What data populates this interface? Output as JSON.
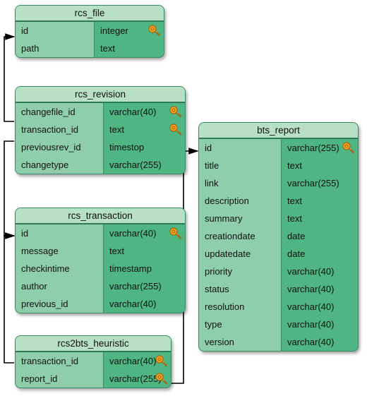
{
  "tables": {
    "rcs_file": {
      "title": "rcs_file",
      "cols": [
        {
          "name": "id",
          "type": "integer",
          "key": true
        },
        {
          "name": "path",
          "type": "text",
          "key": false
        }
      ]
    },
    "rcs_revision": {
      "title": "rcs_revision",
      "cols": [
        {
          "name": "changefile_id",
          "type": "varchar(40)",
          "key": true
        },
        {
          "name": "transaction_id",
          "type": "text",
          "key": true
        },
        {
          "name": "previousrev_id",
          "type": "timestop",
          "key": false
        },
        {
          "name": "changetype",
          "type": "varchar(255)",
          "key": false
        }
      ]
    },
    "rcs_transaction": {
      "title": "rcs_transaction",
      "cols": [
        {
          "name": "id",
          "type": "varchar(40)",
          "key": true
        },
        {
          "name": "message",
          "type": "text",
          "key": false
        },
        {
          "name": "checkintime",
          "type": "timestamp",
          "key": false
        },
        {
          "name": "author",
          "type": "varchar(255)",
          "key": false
        },
        {
          "name": "previous_id",
          "type": "varchar(40)",
          "key": false
        }
      ]
    },
    "rcs2bts_heuristic": {
      "title": "rcs2bts_heuristic",
      "cols": [
        {
          "name": "transaction_id",
          "type": "varchar(40)",
          "key": true
        },
        {
          "name": "report_id",
          "type": "varchar(255)",
          "key": true
        }
      ]
    },
    "bts_report": {
      "title": "bts_report",
      "cols": [
        {
          "name": "id",
          "type": "varchar(255)",
          "key": true
        },
        {
          "name": "title",
          "type": "text",
          "key": false
        },
        {
          "name": "link",
          "type": "varchar(255)",
          "key": false
        },
        {
          "name": "description",
          "type": "text",
          "key": false
        },
        {
          "name": "summary",
          "type": "text",
          "key": false
        },
        {
          "name": "creationdate",
          "type": "date",
          "key": false
        },
        {
          "name": "updatedate",
          "type": "date",
          "key": false
        },
        {
          "name": "priority",
          "type": "varchar(40)",
          "key": false
        },
        {
          "name": "status",
          "type": "varchar(40)",
          "key": false
        },
        {
          "name": "resolution",
          "type": "varchar(40)",
          "key": false
        },
        {
          "name": "type",
          "type": "varchar(40)",
          "key": false
        },
        {
          "name": "version",
          "type": "varchar(40)",
          "key": false
        }
      ]
    }
  }
}
